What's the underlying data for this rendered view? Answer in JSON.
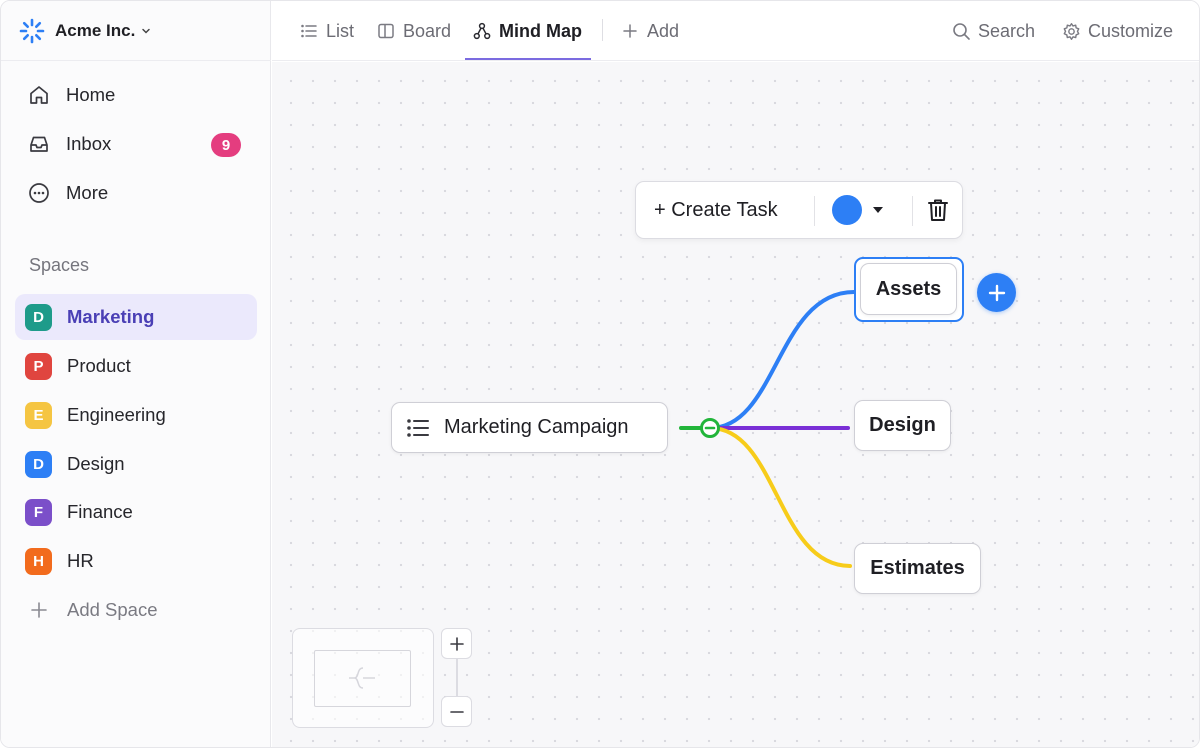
{
  "workspace": {
    "name": "Acme Inc."
  },
  "nav": {
    "home": "Home",
    "inbox": "Inbox",
    "inbox_badge": "9",
    "more": "More"
  },
  "spaces": {
    "title": "Spaces",
    "items": [
      {
        "letter": "D",
        "label": "Marketing",
        "color": "#1e9b8a"
      },
      {
        "letter": "P",
        "label": "Product",
        "color": "#e0453f"
      },
      {
        "letter": "E",
        "label": "Engineering",
        "color": "#f5c542"
      },
      {
        "letter": "D",
        "label": "Design",
        "color": "#2d7ff5"
      },
      {
        "letter": "F",
        "label": "Finance",
        "color": "#7b4fc9"
      },
      {
        "letter": "H",
        "label": "HR",
        "color": "#f26b1d"
      }
    ],
    "add_label": "Add Space"
  },
  "tabs": {
    "list": "List",
    "board": "Board",
    "mindmap": "Mind Map",
    "add": "Add"
  },
  "actions": {
    "search": "Search",
    "customize": "Customize"
  },
  "node_toolbar": {
    "create_task": "+ Create Task",
    "color": "#2d7ff5"
  },
  "mindmap": {
    "root": "Marketing Campaign",
    "children": [
      "Assets",
      "Design",
      "Estimates"
    ],
    "branch_colors": [
      "#2d7ff5",
      "#7a2fd6",
      "#f7cc1a"
    ],
    "root_connector_color": "#22b53a"
  },
  "colors": {
    "accent": "#7b6be0",
    "active_space_bg": "#ebe9fc",
    "badge": "#e43d7f"
  }
}
